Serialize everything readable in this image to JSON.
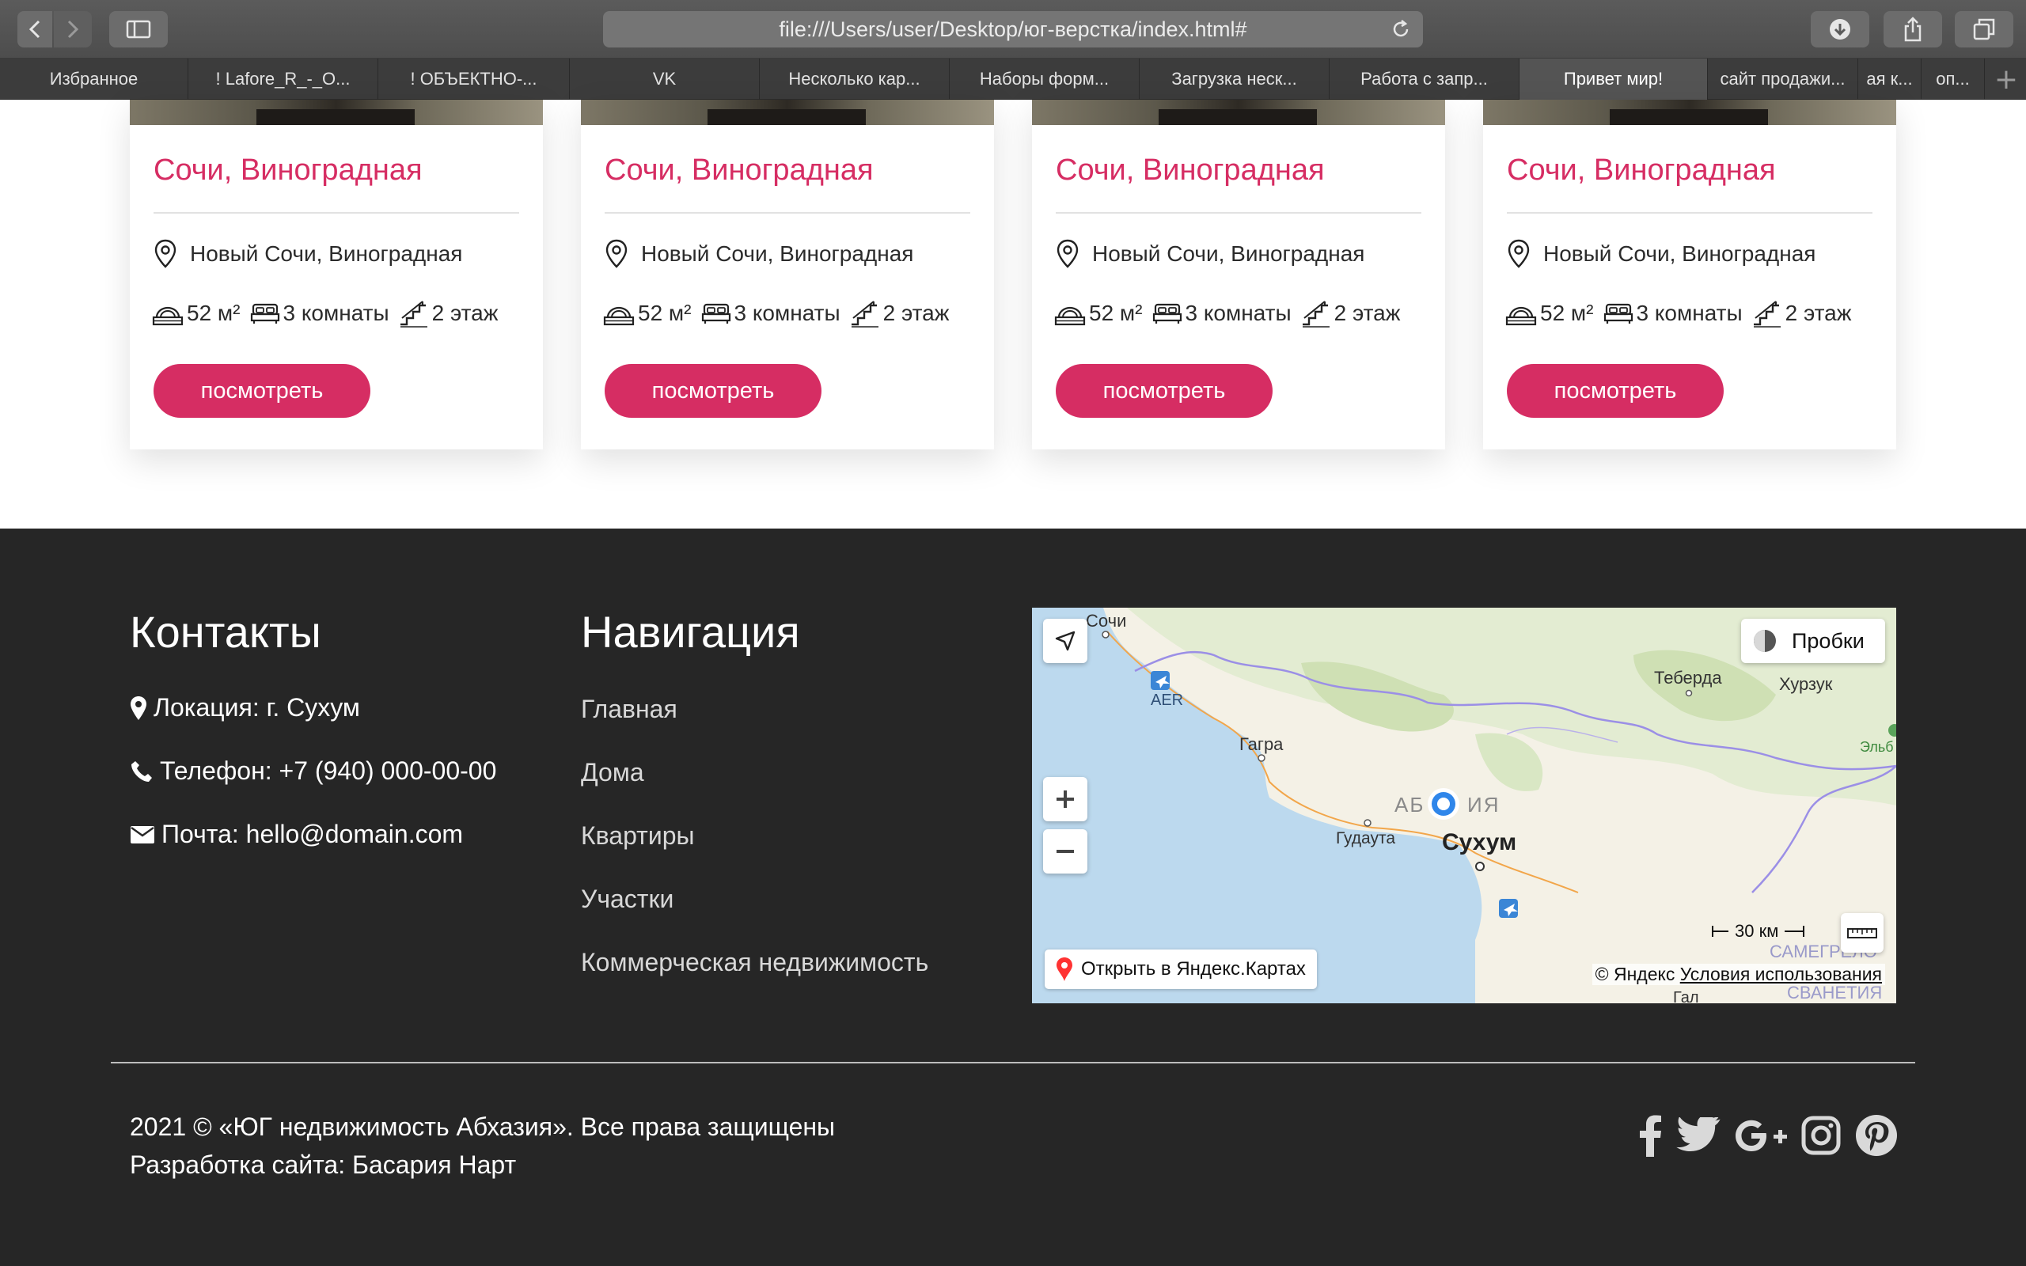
{
  "browser": {
    "url": "file:///Users/user/Desktop/юг-верстка/index.html#",
    "tabs": [
      {
        "label": "Избранное",
        "active": false
      },
      {
        "label": "! Lafore_R_-_O...",
        "active": false
      },
      {
        "label": "! ОБЪЕКТНО-...",
        "active": false
      },
      {
        "label": "VK",
        "active": false
      },
      {
        "label": "Несколько кар...",
        "active": false
      },
      {
        "label": "Наборы форм...",
        "active": false
      },
      {
        "label": "Загрузка неск...",
        "active": false
      },
      {
        "label": "Работа с запр...",
        "active": false
      },
      {
        "label": "Привет мир!",
        "active": true
      },
      {
        "label": "сайт продажи...",
        "active": false
      },
      {
        "label": "ая к...",
        "active": false
      },
      {
        "label": "оп...",
        "active": false
      }
    ]
  },
  "cards": [
    {
      "title": "Сочи, Виноградная",
      "address": "Новый Сочи, Виноградная",
      "area": "52 м²",
      "rooms": "3 комнаты",
      "floor": "2 этаж",
      "button": "посмотреть"
    },
    {
      "title": "Сочи, Виноградная",
      "address": "Новый Сочи, Виноградная",
      "area": "52 м²",
      "rooms": "3 комнаты",
      "floor": "2 этаж",
      "button": "посмотреть"
    },
    {
      "title": "Сочи, Виноградная",
      "address": "Новый Сочи, Виноградная",
      "area": "52 м²",
      "rooms": "3 комнаты",
      "floor": "2 этаж",
      "button": "посмотреть"
    },
    {
      "title": "Сочи, Виноградная",
      "address": "Новый Сочи, Виноградная",
      "area": "52 м²",
      "rooms": "3 комнаты",
      "floor": "2 этаж",
      "button": "посмотреть"
    }
  ],
  "footer": {
    "contacts": {
      "heading": "Контакты",
      "location": "Локация: г. Сухум",
      "phone": "Телефон: +7 (940) 000-00-00",
      "email": "Почта: hello@domain.com"
    },
    "navigation": {
      "heading": "Навигация",
      "links": [
        "Главная",
        "Дома",
        "Квартиры",
        "Участки",
        "Коммерческая недвижимость"
      ]
    },
    "map": {
      "traffic": "Пробки",
      "open_in": "Открыть в Яндекс.Картах",
      "copyright": "© Яндекс",
      "terms": "Условия использования",
      "scale": "30 км",
      "labels": {
        "sochi": "Сочи",
        "aer": "AER",
        "gagra": "Гагра",
        "abkhazia_left": "АБ",
        "abkhazia_right": "ИЯ",
        "gudauta": "Гудаута",
        "sukhum": "Сухум",
        "teberda": "Теберда",
        "khurzuk": "Хурзук",
        "elbrus": "Эльб",
        "samegrelo": "САМЕГРЕЛО",
        "svaneti": "СВАНЕТИЯ",
        "gal": "Гал"
      }
    },
    "copyright": "2021 © «ЮГ недвижимость Абхазия». Все права защищены",
    "developer": "Разработка сайта: Басария Нарт",
    "colors": {
      "accent": "#d62d63",
      "footer_bg": "#262626"
    }
  }
}
